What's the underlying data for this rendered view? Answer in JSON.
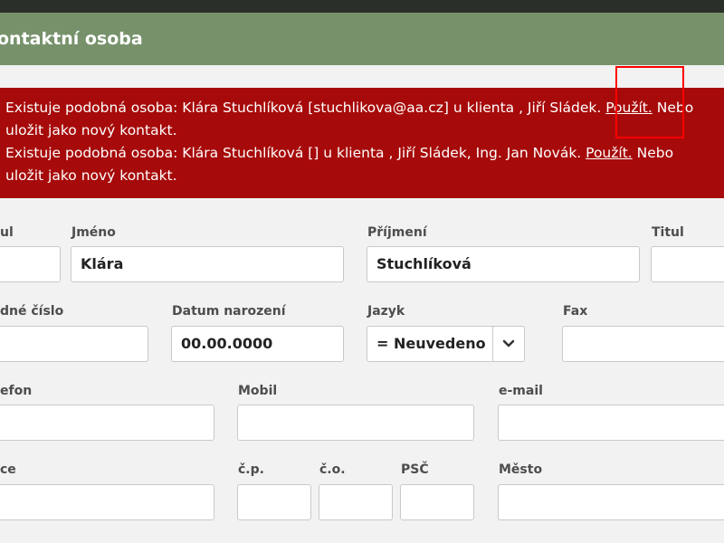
{
  "dialog": {
    "title": "ontaktní osoba"
  },
  "alert": {
    "line1": {
      "text": "Existuje podobná osoba: Klára Stuchlíková [stuchlikova@aa.cz] u klienta , Jiří Sládek. ",
      "link": "Použít.",
      "after": " Nebo",
      "wrap": "uložit jako nový kontakt."
    },
    "line2": {
      "text": "Existuje podobná osoba: Klára Stuchlíková [] u klienta , Jiří Sládek, Ing. Jan Novák. ",
      "link": "Použít.",
      "after": " Nebo",
      "wrap": "uložit jako nový kontakt."
    }
  },
  "labels": {
    "titul_before": "ul",
    "jmeno": "Jméno",
    "prijmeni": "Příjmení",
    "titul_after": "Titul",
    "rodne_cislo": "dné číslo",
    "datum_narozeni": "Datum narození",
    "jazyk": "Jazyk",
    "fax": "Fax",
    "telefon": "efon",
    "mobil": "Mobil",
    "email": "e-mail",
    "ulice": "ce",
    "cp": "č.p.",
    "co": "č.o.",
    "psc": "PSČ",
    "mesto": "Město"
  },
  "fields": {
    "titul_before": "",
    "jmeno": "Klára",
    "prijmeni": "Stuchlíková",
    "titul_after": "",
    "rodne_cislo": "",
    "datum_narozeni": "00.00.0000",
    "jazyk": "= Neuvedeno",
    "fax": "",
    "telefon": "",
    "mobil": "",
    "email": "",
    "ulice": "",
    "cp": "",
    "co": "",
    "psc": "",
    "mesto": ""
  },
  "icons": {
    "select_arrow": "chevron-down-icon"
  }
}
